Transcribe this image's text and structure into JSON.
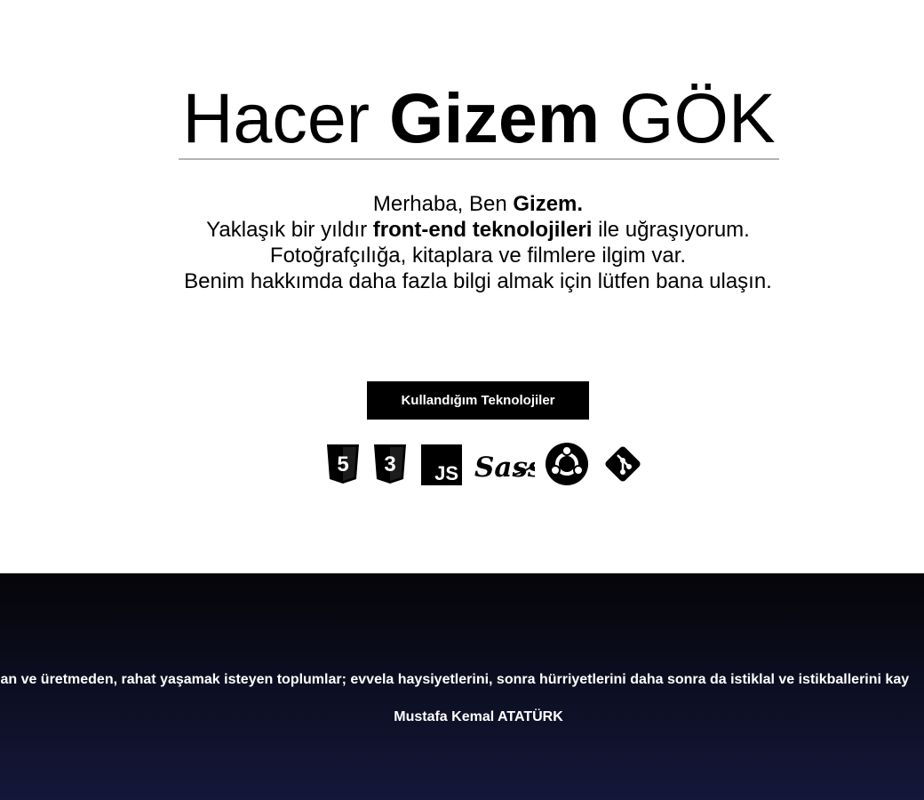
{
  "header": {
    "name_first": "Hacer ",
    "name_bold": "Gizem",
    "name_last": " GÖK"
  },
  "intro": {
    "line1_prefix": "Merhaba, Ben ",
    "line1_bold": "Gizem.",
    "line2_prefix": "Yaklaşık bir yıldır ",
    "line2_bold": "front-end teknolojileri",
    "line2_suffix": " ile uğraşıyorum.",
    "line3": "Fotoğrafçılığa, kitaplara ve filmlere ilgim var.",
    "line4": "Benim hakkımda daha fazla bilgi almak için lütfen bana ulaşın."
  },
  "tech_button": {
    "label": "Kullandığım Teknolojiler"
  },
  "technologies": {
    "html5_badge": "5",
    "css3_badge": "3",
    "js_badge": "JS",
    "sass_badge": "Sass",
    "items": [
      "html5-icon",
      "css3-icon",
      "javascript-icon",
      "sass-icon",
      "ubuntu-icon",
      "git-icon"
    ]
  },
  "footer": {
    "quote": "nadan ve üretmeden, rahat yaşamak isteyen toplumlar; evvela haysiyetlerini, sonra hürriyetlerini daha sonra da istiklal ve istikballerini kay",
    "author": "Mustafa Kemal ATATÜRK",
    "colors": {
      "background_top": "#050508",
      "background_bottom": "#15173a",
      "text": "#ffffff"
    }
  },
  "colors": {
    "primary_text": "#000000",
    "button_bg": "#000000",
    "button_text": "#ffffff",
    "title_rule": "#b3b3b3"
  }
}
